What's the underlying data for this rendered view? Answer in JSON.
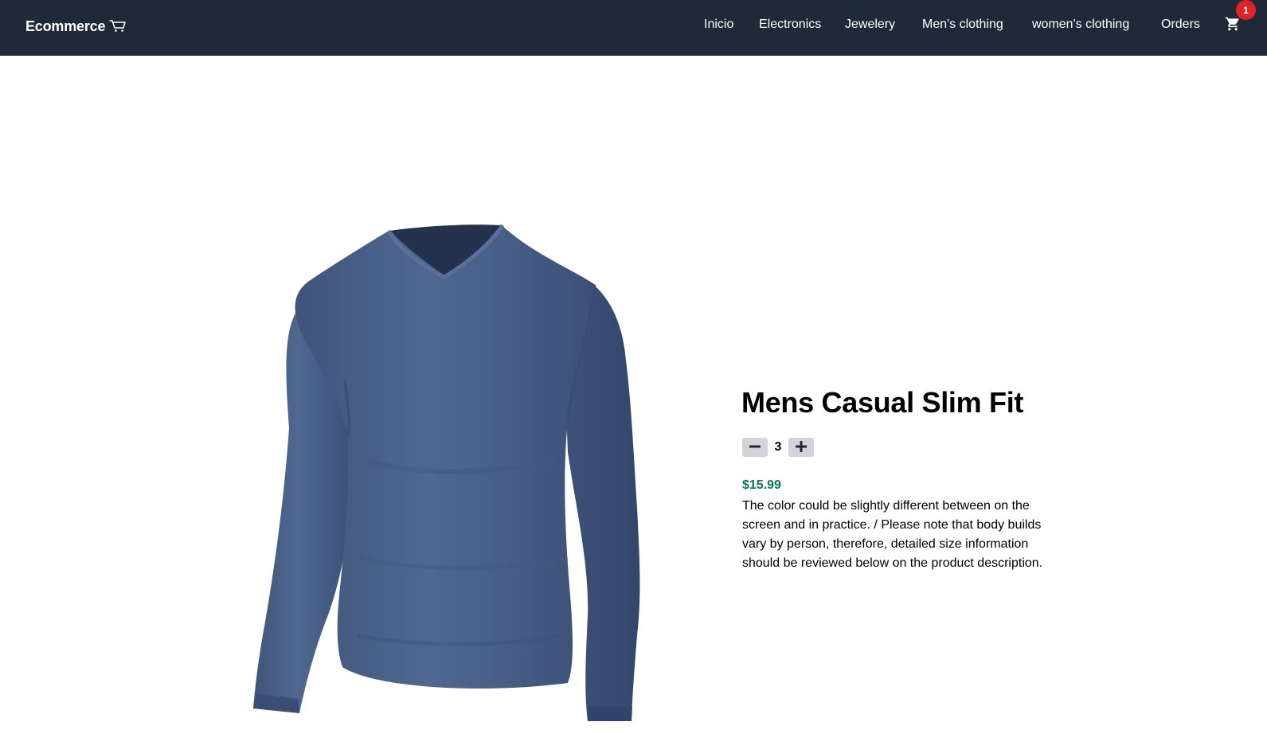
{
  "navbar": {
    "brand": "Ecommerce",
    "brand_icon": "cart-outline-icon",
    "links": [
      {
        "label": "Inicio"
      },
      {
        "label": "Electronics"
      },
      {
        "label": "Jewelery"
      },
      {
        "label": "Men's clothing"
      },
      {
        "label": "women's clothing"
      },
      {
        "label": "Orders"
      }
    ],
    "cart_icon": "shopping-cart-icon",
    "cart_count": "1"
  },
  "product": {
    "image_subject": "blue long-sleeve v-neck t-shirt",
    "title": "Mens Casual Slim Fit",
    "quantity": "3",
    "price": "$15.99",
    "description": "The color could be slightly different between on the screen and in practice. / Please note that body builds vary by person, therefore, detailed size information should be reviewed below on the product description."
  },
  "colors": {
    "navbar_bg": "#1f2937",
    "price": "#047857",
    "badge": "#dc2626",
    "qty_button": "#d1d5db",
    "shirt": "#4a5f85"
  }
}
